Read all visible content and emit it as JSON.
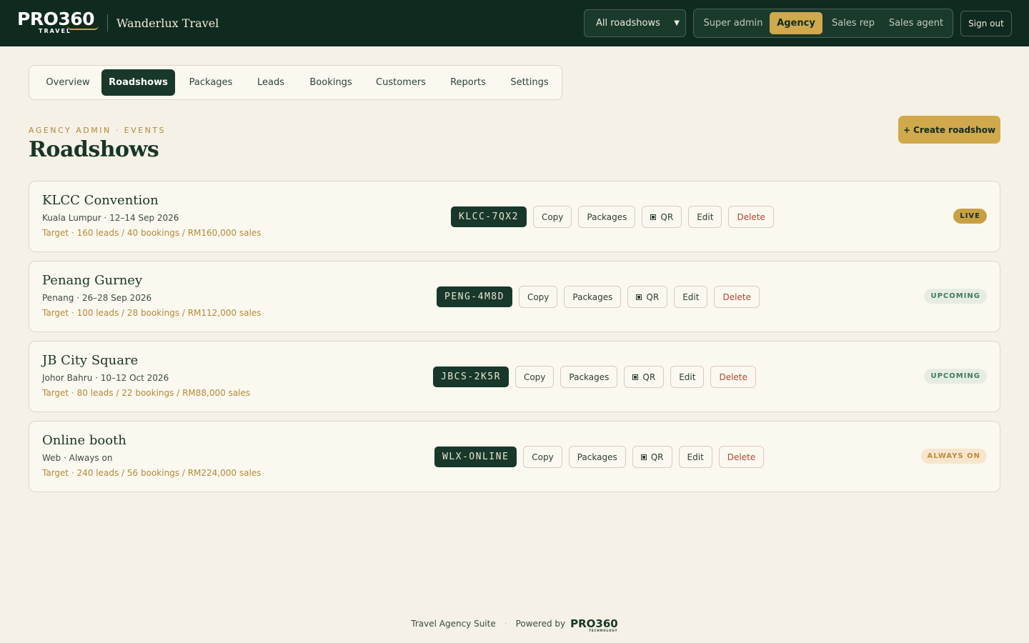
{
  "header": {
    "logo_main": "PRO360",
    "logo_sub": "TRAVEL",
    "agency_name": "Wanderlux Travel",
    "view_select": {
      "selected": "All roadshows"
    },
    "roles": [
      {
        "label": "Super admin",
        "active": false
      },
      {
        "label": "Agency",
        "active": true
      },
      {
        "label": "Sales rep",
        "active": false
      },
      {
        "label": "Sales agent",
        "active": false
      }
    ],
    "sign_out": "Sign out"
  },
  "tabs": [
    {
      "label": "Overview",
      "active": false
    },
    {
      "label": "Roadshows",
      "active": true
    },
    {
      "label": "Packages",
      "active": false
    },
    {
      "label": "Leads",
      "active": false
    },
    {
      "label": "Bookings",
      "active": false
    },
    {
      "label": "Customers",
      "active": false
    },
    {
      "label": "Reports",
      "active": false
    },
    {
      "label": "Settings",
      "active": false
    }
  ],
  "page": {
    "eyebrow": "AGENCY ADMIN · EVENTS",
    "title": "Roadshows",
    "create_label": "+ Create roadshow"
  },
  "action_labels": {
    "copy": "Copy",
    "packages": "Packages",
    "qr": "QR",
    "edit": "Edit",
    "delete": "Delete"
  },
  "roadshows": [
    {
      "name": "KLCC Convention",
      "meta": "Kuala Lumpur · 12–14 Sep 2026",
      "target": "Target · 160 leads / 40 bookings / RM160,000 sales",
      "code": "KLCC-7QX2",
      "status": "LIVE",
      "status_kind": "live"
    },
    {
      "name": "Penang Gurney",
      "meta": "Penang · 26–28 Sep 2026",
      "target": "Target · 100 leads / 28 bookings / RM112,000 sales",
      "code": "PENG-4M8D",
      "status": "UPCOMING",
      "status_kind": "upcoming"
    },
    {
      "name": "JB City Square",
      "meta": "Johor Bahru · 10–12 Oct 2026",
      "target": "Target · 80 leads / 22 bookings / RM88,000 sales",
      "code": "JBCS-2K5R",
      "status": "UPCOMING",
      "status_kind": "upcoming"
    },
    {
      "name": "Online booth",
      "meta": "Web · Always on",
      "target": "Target · 240 leads / 56 bookings / RM224,000 sales",
      "code": "WLX-ONLINE",
      "status": "ALWAYS ON",
      "status_kind": "always"
    }
  ],
  "footer": {
    "suite": "Travel Agency Suite",
    "powered_by": "Powered by",
    "logo": "PRO360",
    "logo_sub": "TECHNOLOGY"
  }
}
